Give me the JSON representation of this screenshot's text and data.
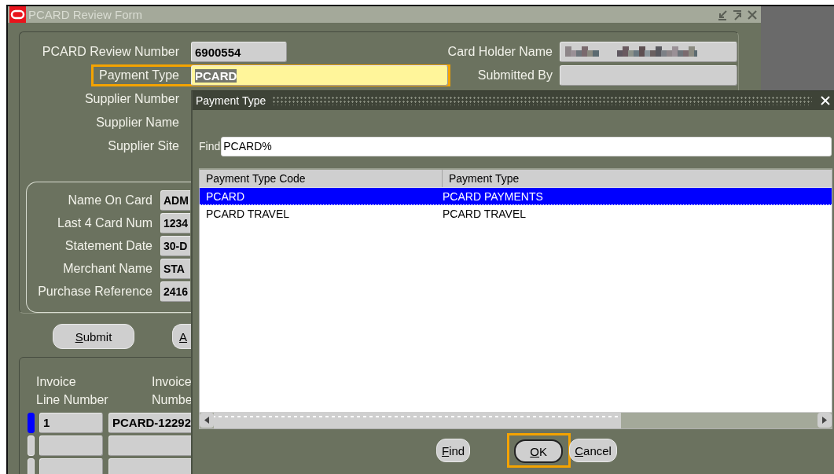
{
  "main_window": {
    "title": "PCARD Review Form",
    "active": false,
    "header_fields": [
      {
        "label": "PCARD Review Number",
        "value": "6900554",
        "focused": false,
        "text_selected": false,
        "highlighted": false
      },
      {
        "label": "Payment Type",
        "value": "PCARD",
        "focused": true,
        "text_selected": true,
        "highlighted": true
      },
      {
        "label": "Supplier Number"
      },
      {
        "label": "Supplier Name"
      },
      {
        "label": "Supplier Site"
      }
    ],
    "right_fields": [
      {
        "label": "Card Holder Name",
        "blurred": true
      },
      {
        "label": "Submitted By",
        "blurred": false
      }
    ],
    "card_fields": [
      {
        "label": "Name On Card",
        "value": "ADM"
      },
      {
        "label": "Last 4 Card Num",
        "value": "1234"
      },
      {
        "label": "Statement Date",
        "value": "30-D"
      },
      {
        "label": "Merchant Name",
        "value": "STA"
      },
      {
        "label": "Purchase Reference",
        "value": "2416"
      }
    ],
    "buttons": [
      {
        "label": "Submit"
      },
      {
        "label": "A"
      }
    ],
    "lines": {
      "columns": [
        {
          "lines": [
            "Invoice",
            "Line Number"
          ]
        },
        {
          "lines": [
            "Invoice",
            "Numbe"
          ]
        }
      ],
      "rows": [
        {
          "line_number": "1",
          "invoice_number": "PCARD-12292",
          "current": true
        },
        {
          "current": false
        },
        {
          "current": false
        }
      ]
    }
  },
  "dialog": {
    "title": "Payment Type",
    "find": {
      "label": "Find",
      "value": "PCARD%"
    },
    "columns": [
      "Payment Type Code",
      "Payment Type"
    ],
    "rows": [
      {
        "cells": [
          "PCARD",
          "PCARD PAYMENTS"
        ],
        "selected": true
      },
      {
        "cells": [
          "PCARD TRAVEL",
          "PCARD TRAVEL"
        ],
        "selected": false
      }
    ],
    "buttons": [
      {
        "label": "Find",
        "default": false,
        "highlighted": false
      },
      {
        "label": "OK",
        "default": true,
        "highlighted": true
      },
      {
        "label": "Cancel",
        "default": false,
        "highlighted": false
      }
    ]
  }
}
